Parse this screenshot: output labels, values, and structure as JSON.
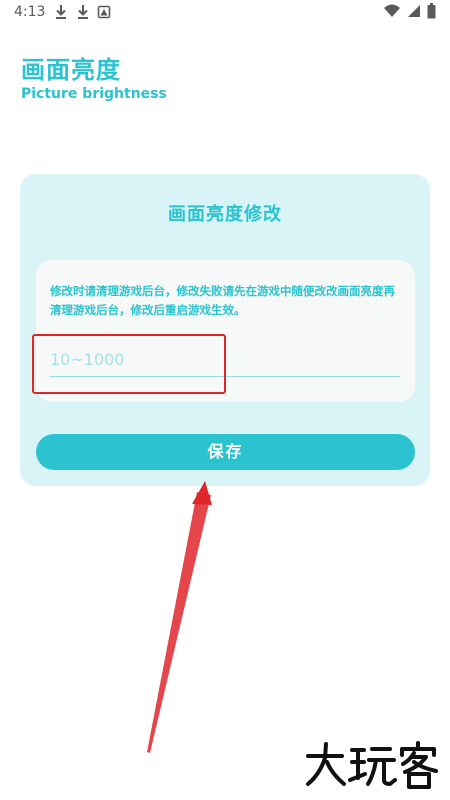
{
  "status_bar": {
    "time": "4:13",
    "left_icons": [
      "download-icon",
      "download-icon",
      "image-icon"
    ],
    "right_icons": [
      "wifi-icon",
      "signal-icon",
      "battery-icon"
    ]
  },
  "header": {
    "title": "画面亮度",
    "subtitle": "Picture brightness"
  },
  "card": {
    "title": "画面亮度修改",
    "notice": "修改时请清理游戏后台，修改失败请先在游戏中随便改改画面亮度再清理游戏后台，修改后重启游戏生效。",
    "input": {
      "value": "",
      "placeholder": "10~1000"
    },
    "save_label": "保存"
  },
  "watermark": {
    "text": "大玩客"
  },
  "colors": {
    "accent": "#2bc3cf",
    "card_bg": "#d9f4f7",
    "panel_bg": "#f7f8f8",
    "annotation": "#e0262b"
  }
}
